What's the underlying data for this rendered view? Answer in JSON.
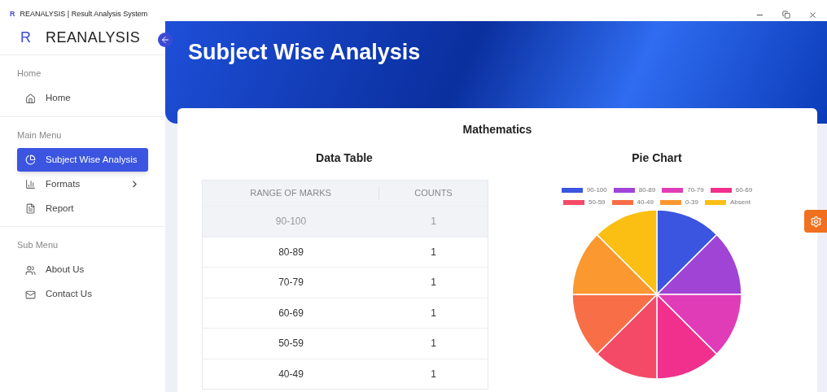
{
  "window": {
    "title": "REANALYSIS | Result Analysis System",
    "logo": "R"
  },
  "sidebar": {
    "brand_letter": "R",
    "brand": "REANALYSIS",
    "sections": [
      {
        "title": "Home",
        "items": [
          {
            "label": "Home",
            "selected": false,
            "submenu": false
          }
        ]
      },
      {
        "title": "Main Menu",
        "items": [
          {
            "label": "Subject Wise Analysis",
            "selected": true,
            "submenu": false
          },
          {
            "label": "Formats",
            "selected": false,
            "submenu": true
          },
          {
            "label": "Report",
            "selected": false,
            "submenu": false
          }
        ]
      },
      {
        "title": "Sub Menu",
        "items": [
          {
            "label": "About Us",
            "selected": false,
            "submenu": false
          },
          {
            "label": "Contact Us",
            "selected": false,
            "submenu": false
          }
        ]
      }
    ]
  },
  "page_title": "Subject Wise Analysis",
  "subject": "Mathematics",
  "table": {
    "title": "Data Table",
    "columns": [
      "RANGE OF MARKS",
      "COUNTS"
    ],
    "rows": [
      {
        "cells": [
          "90-100",
          "1"
        ],
        "selected": true
      },
      {
        "cells": [
          "80-89",
          "1"
        ],
        "selected": false
      },
      {
        "cells": [
          "70-79",
          "1"
        ],
        "selected": false
      },
      {
        "cells": [
          "60-69",
          "1"
        ],
        "selected": false
      },
      {
        "cells": [
          "50-59",
          "1"
        ],
        "selected": false
      },
      {
        "cells": [
          "40-49",
          "1"
        ],
        "selected": false
      }
    ]
  },
  "pie": {
    "title": "Pie Chart",
    "chart_data": {
      "type": "pie",
      "legend": true,
      "categories": [
        "90-100",
        "80-89",
        "70-79",
        "60-69",
        "50-59",
        "40-49",
        "0-39",
        "Absent"
      ],
      "series": [
        {
          "colors": [
            "#3b55e0",
            "#a044d6",
            "#e03cb8",
            "#f0308c",
            "#f44a68",
            "#f86e46",
            "#fb9830",
            "#fbbf14"
          ],
          "values": [
            12.5,
            12.5,
            12.5,
            12.5,
            12.5,
            12.5,
            12.5,
            12.5
          ]
        }
      ]
    }
  }
}
